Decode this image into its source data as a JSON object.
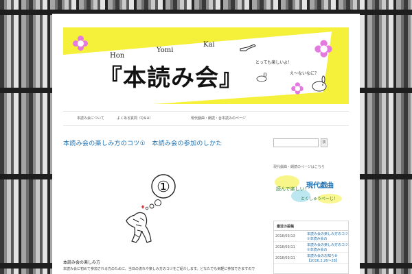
{
  "header": {
    "title": "『本読み会』",
    "reading_hon": "Hon",
    "reading_yomi": "Yomi",
    "reading_kai": "Kai",
    "tagline_1": "とっても楽しいよ！",
    "tagline_2": "え～ないなに？"
  },
  "nav": {
    "items": [
      {
        "label": "本読み会について"
      },
      {
        "label": "よくある質問（Q＆A）"
      },
      {
        "label": "現代戯曲・朗読・台本読みのページ"
      }
    ]
  },
  "post": {
    "title": "本読み会の楽しみ方のコツ①　本読み会の参加のしかた",
    "number": "①",
    "subheading": "本読み会の楽しみ方",
    "body": "本読み会に初めて参加される方のために、当日の流れや楽しみ方のコツをご紹介します。どなたでも気軽に参加できますので"
  },
  "sidebar": {
    "search_placeholder": "",
    "search_button": "検",
    "banner_label": "現代戯曲・朗読のページはこちら",
    "banner_line1": "読んで楽しい！",
    "banner_line2": "現代戯曲",
    "banner_line3": "とくしゅうぺーじ！",
    "recent_title": "最近の投稿",
    "recent": [
      {
        "date": "2016/03/13",
        "title": "本読み会の楽しみ方のコツ①本読み会の"
      },
      {
        "date": "2016/03/11",
        "title": "本読み会の楽しみ方のコツ②本読み会の"
      },
      {
        "date": "2016/03/11",
        "title": "本読み会のお知らせ【2016.2.26～28】"
      }
    ]
  },
  "colors": {
    "accent_yellow": "#f5f03a",
    "flower_pink": "#e47ae0",
    "link_blue": "#1a6fb0"
  }
}
